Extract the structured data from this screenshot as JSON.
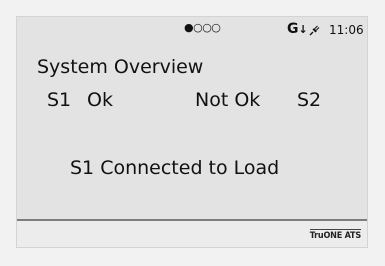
{
  "status_bar": {
    "page_indicator": "●○○○",
    "generator_icon": "generator-download-icon",
    "generator_glyph": "G",
    "generator_arrow": "↓",
    "power_icon": "plug-icon",
    "time": "11:06"
  },
  "main": {
    "title": "System Overview",
    "sources": {
      "s1_label": "S1",
      "s1_status": "Ok",
      "s2_status": "Not Ok",
      "s2_label": "S2"
    },
    "connection_message": "S1 Connected to Load"
  },
  "footer": {
    "brand": "TruONE ATS"
  }
}
